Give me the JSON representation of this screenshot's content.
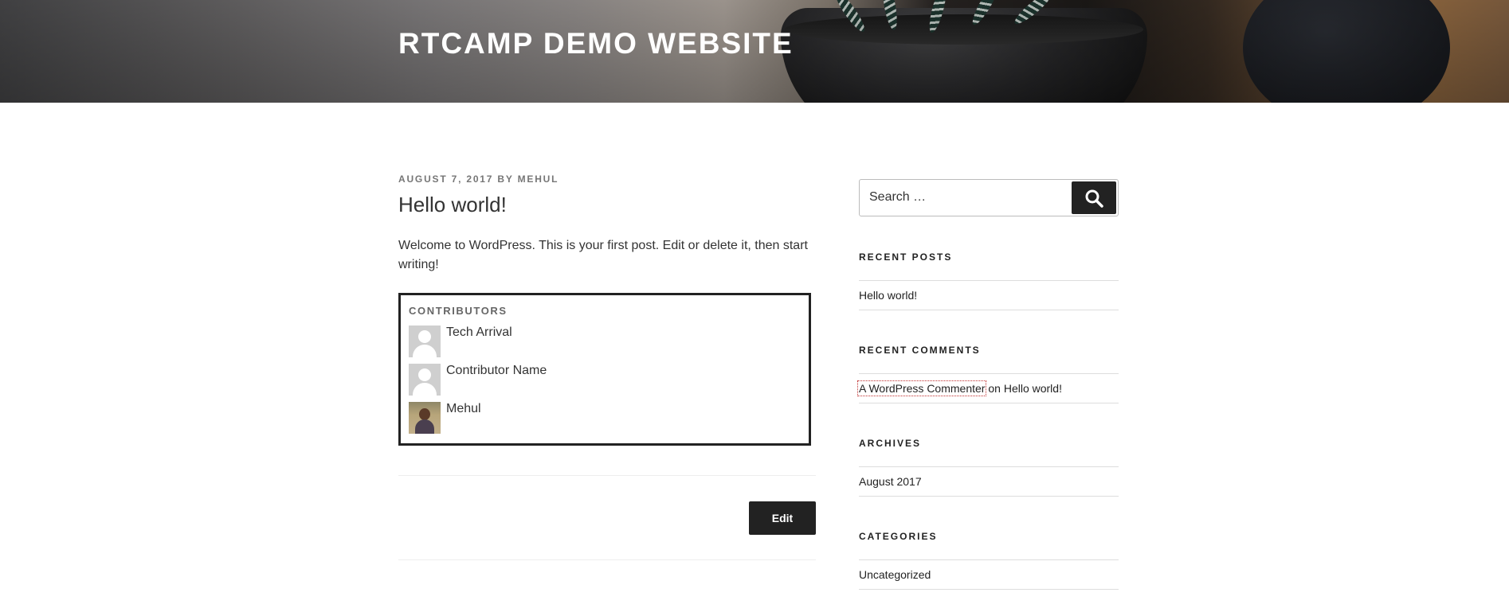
{
  "header": {
    "site_title": "RTCAMP DEMO WEBSITE"
  },
  "post": {
    "date": "AUGUST 7, 2017",
    "by": "BY",
    "author": "MEHUL",
    "title": "Hello world!",
    "content": "Welcome to WordPress. This is your first post. Edit or delete it, then start writing!",
    "contributors": {
      "title": "CONTRIBUTORS",
      "items": [
        {
          "name": "Tech Arrival",
          "avatar": "default-avatar-icon"
        },
        {
          "name": "Contributor Name",
          "avatar": "default-avatar-icon"
        },
        {
          "name": "Mehul",
          "avatar": "photo-avatar"
        }
      ]
    },
    "edit_label": "Edit"
  },
  "sidebar": {
    "search": {
      "placeholder": "Search …",
      "button_icon": "search-icon"
    },
    "recent_posts": {
      "title": "RECENT POSTS",
      "items": [
        "Hello world!"
      ]
    },
    "recent_comments": {
      "title": "RECENT COMMENTS",
      "items": [
        {
          "author": "A WordPress Commenter",
          "on": "on",
          "post": "Hello world!"
        }
      ]
    },
    "archives": {
      "title": "ARCHIVES",
      "items": [
        "August 2017"
      ]
    },
    "categories": {
      "title": "CATEGORIES",
      "items": [
        "Uncategorized"
      ]
    }
  },
  "colors": {
    "button_bg": "#222222",
    "text": "#333333",
    "meta": "#767676"
  }
}
